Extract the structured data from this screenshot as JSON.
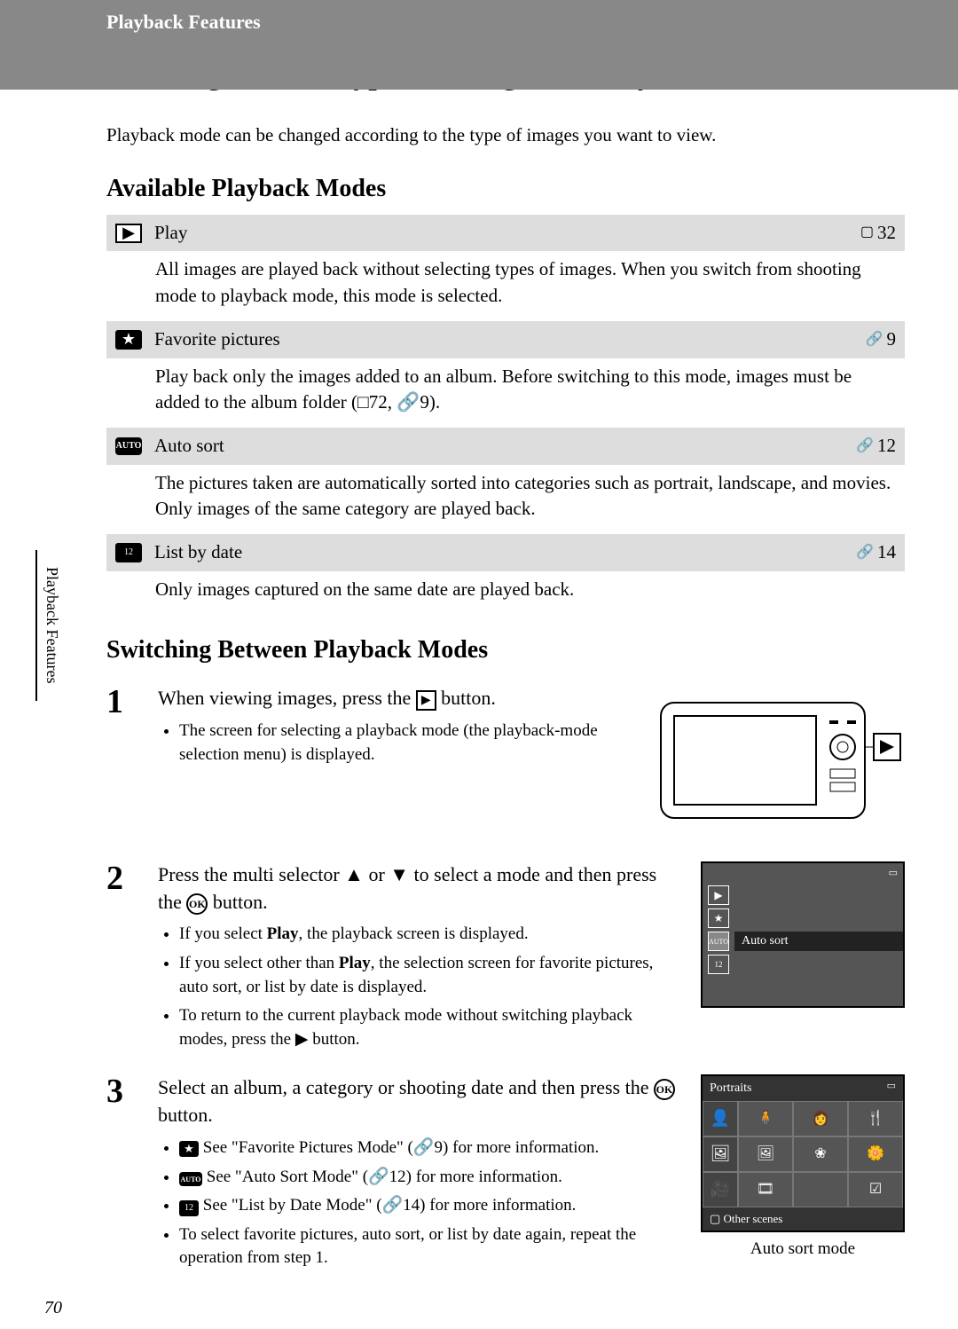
{
  "header": {
    "section": "Playback Features"
  },
  "title": "Selecting Certain Types of Images for Playback",
  "intro": "Playback mode can be changed according to the type of images you want to view.",
  "h2a": "Available Playback Modes",
  "modes": [
    {
      "label": "Play",
      "ref_prefix": "book",
      "ref": "32",
      "desc": "All images are played back without selecting types of images. When you switch from shooting mode to playback mode, this mode is selected."
    },
    {
      "label": "Favorite pictures",
      "ref_prefix": "link",
      "ref": "9",
      "desc": "Play back only the images added to an album. Before switching to this mode, images must be added to the album folder (□72, 🔗9)."
    },
    {
      "label": "Auto sort",
      "ref_prefix": "link",
      "ref": "12",
      "desc": "The pictures taken are automatically sorted into categories such as portrait, landscape, and movies. Only images of the same category are played back."
    },
    {
      "label": "List by date",
      "ref_prefix": "link",
      "ref": "14",
      "desc": "Only images captured on the same date are played back."
    }
  ],
  "h2b": "Switching Between Playback Modes",
  "sidetab": "Playback Features",
  "steps": {
    "s1": {
      "title_a": "When viewing images, press the ",
      "title_b": " button.",
      "b1": "The screen for selecting a playback mode (the playback-mode selection menu) is displayed."
    },
    "s2": {
      "title": "Press the multi selector ▲ or ▼ to select a mode and then press the ",
      "title_b": " button.",
      "b1_a": "If you select ",
      "b1_bold": "Play",
      "b1_b": ", the playback screen is displayed.",
      "b2_a": "If you select other than ",
      "b2_bold": "Play",
      "b2_b": ", the selection screen for favorite pictures, auto sort, or list by date is displayed.",
      "b3": "To return to the current playback mode without switching playback modes, press the ▶ button.",
      "screen_label": "Auto sort"
    },
    "s3": {
      "title": "Select an album, a category or shooting date and then press the ",
      "title_b": " button.",
      "b1": " See \"Favorite Pictures Mode\" (🔗9) for more information.",
      "b2": " See \"Auto Sort Mode\" (🔗12) for more information.",
      "b3": " See \"List by Date Mode\" (🔗14) for more information.",
      "b4": "To select favorite pictures, auto sort, or list by date again, repeat the operation from step 1.",
      "screen_title": "Portraits",
      "screen_foot": "Other scenes",
      "caption": "Auto sort mode"
    }
  },
  "ok_text": "OK",
  "page_number": "70"
}
